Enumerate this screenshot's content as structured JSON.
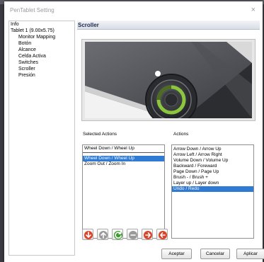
{
  "window": {
    "title": "PenTablet Setting",
    "close_glyph": "×"
  },
  "tree": {
    "items": [
      {
        "label": "Info",
        "level": 0
      },
      {
        "label": "Tablet 1 (9.00x5.75)",
        "level": 0
      },
      {
        "label": "Monitor Mapping",
        "level": 1
      },
      {
        "label": "Botón",
        "level": 1
      },
      {
        "label": "Alcance",
        "level": 1
      },
      {
        "label": "Celda Activa",
        "level": 1
      },
      {
        "label": "Switches",
        "level": 1
      },
      {
        "label": "Scroller",
        "level": 1
      },
      {
        "label": "Presión",
        "level": 1
      }
    ]
  },
  "panel": {
    "title": "Scroller",
    "selected_actions_label": "Selected Actions",
    "actions_label": "Actions",
    "selected_top_value": "Wheel Down / Wheel Up",
    "selected_list": [
      {
        "label": "Wheel Down / Wheel Up",
        "selected": true
      },
      {
        "label": "Zoom Out / Zoom In",
        "selected": false
      }
    ],
    "actions_list": [
      {
        "label": "Arrow Down / Arrow Up",
        "selected": false
      },
      {
        "label": "Arrow Left / Arrow Right",
        "selected": false
      },
      {
        "label": "Volume Down / Volume Up",
        "selected": false
      },
      {
        "label": "Backward / Foreward",
        "selected": false
      },
      {
        "label": "Page Down / Page Up",
        "selected": false
      },
      {
        "label": "Brush - / Brush +",
        "selected": false
      },
      {
        "label": "Layer up / Layer down",
        "selected": false
      },
      {
        "label": "Undo / Redo",
        "selected": true
      }
    ]
  },
  "toolbar_icons": [
    {
      "name": "move-down-icon",
      "color": "#d9442a"
    },
    {
      "name": "move-up-icon",
      "color": "#9a9a9a"
    },
    {
      "name": "reset-icon",
      "color": "#3e9b2f"
    },
    {
      "name": "remove-icon",
      "color": "#9a9a9a"
    },
    {
      "name": "add-icon",
      "color": "#d9442a"
    },
    {
      "name": "back-icon",
      "color": "#d9442a"
    }
  ],
  "buttons": {
    "accept": "Aceptar",
    "cancel": "Cancelar",
    "apply": "Aplicar"
  },
  "colors": {
    "selection": "#2f7ad3",
    "ring_green": "#8cc63f"
  }
}
